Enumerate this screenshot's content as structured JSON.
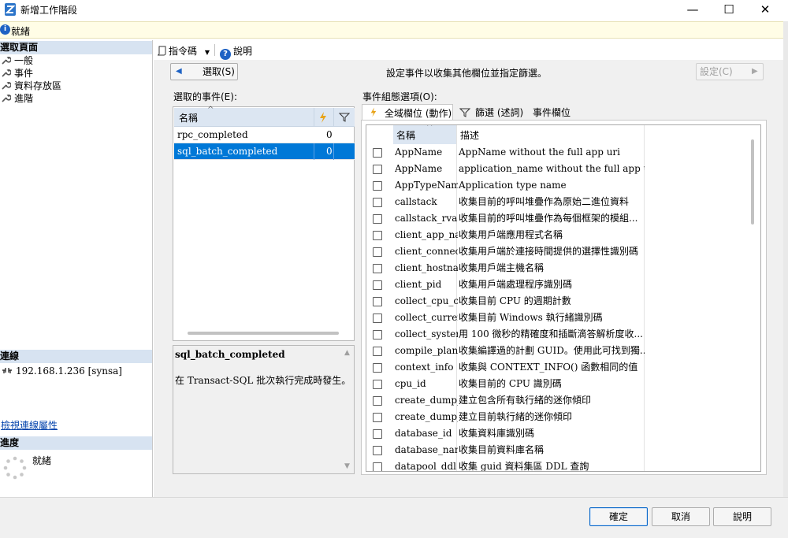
{
  "window": {
    "title": "新增工作階段",
    "minimize": "—",
    "maximize": "☐",
    "close": "✕"
  },
  "status": {
    "text": "就緒"
  },
  "left": {
    "select_page_header": "選取頁面",
    "pages": [
      "一般",
      "事件",
      "資料存放區",
      "進階"
    ],
    "connection_header": "連線",
    "connection_value": "192.168.1.236 [synsa]",
    "view_connection_link": "檢視連線屬性",
    "progress_header": "進度",
    "progress_text": "就緒"
  },
  "toolbar": {
    "script_label": "指令碼",
    "help_label": "說明"
  },
  "nav": {
    "select_button": "選取(S)",
    "instruction": "設定事件以收集其他欄位並指定篩選。",
    "configure_button": "設定(C)"
  },
  "events": {
    "label": "選取的事件(E):",
    "column_name": "名稱",
    "rows": [
      {
        "name": "rpc_completed",
        "count": "0"
      },
      {
        "name": "sql_batch_completed",
        "count": "0"
      }
    ]
  },
  "description": {
    "title": "sql_batch_completed",
    "text": "在 Transact-SQL 批次執行完成時發生。"
  },
  "config": {
    "label": "事件組態選項(O):",
    "tabs": [
      "全域欄位 (動作)",
      "篩選 (述詞)",
      "事件欄位"
    ],
    "col_name": "名稱",
    "col_desc": "描述",
    "fields": [
      {
        "name": "AppName",
        "desc": "AppName without the full app uri"
      },
      {
        "name": "AppName",
        "desc": "application_name without the full app uri"
      },
      {
        "name": "AppTypeName",
        "desc": "Application type name"
      },
      {
        "name": "callstack",
        "desc": "收集目前的呼叫堆疊作為原始二進位資料"
      },
      {
        "name": "callstack_rva",
        "desc": "收集目前的呼叫堆疊作為每個框架的模組..."
      },
      {
        "name": "client_app_na...",
        "desc": "收集用戶端應用程式名稱"
      },
      {
        "name": "client_connect...",
        "desc": "收集用戶端於連接時間提供的選擇性識別碼"
      },
      {
        "name": "client_hostname",
        "desc": "收集用戶端主機名稱"
      },
      {
        "name": "client_pid",
        "desc": "收集用戶端處理程序識別碼"
      },
      {
        "name": "collect_cpu_c...",
        "desc": "收集目前 CPU 的週期計數"
      },
      {
        "name": "collect_curren...",
        "desc": "收集目前 Windows 執行緒識別碼"
      },
      {
        "name": "collect_system...",
        "desc": "用 100 微秒的精確度和插斷滴答解析度收..."
      },
      {
        "name": "compile_plan...",
        "desc": "收集編譯過的計劃 GUID。使用此可找到獨..."
      },
      {
        "name": "context_info",
        "desc": "收集與 CONTEXT_INFO() 函數相同的值"
      },
      {
        "name": "cpu_id",
        "desc": "收集目前的 CPU 識別碼"
      },
      {
        "name": "create_dump_...",
        "desc": "建立包含所有執行緒的迷你傾印"
      },
      {
        "name": "create_dump_...",
        "desc": "建立目前執行緒的迷你傾印"
      },
      {
        "name": "database_id",
        "desc": "收集資料庫識別碼"
      },
      {
        "name": "database_name",
        "desc": "收集目前資料庫名稱"
      },
      {
        "name": "datapool_ddl_...",
        "desc": "收集 guid 資料集區 DDL 查詢"
      }
    ]
  },
  "footer": {
    "ok": "確定",
    "cancel": "取消",
    "help": "說明"
  }
}
